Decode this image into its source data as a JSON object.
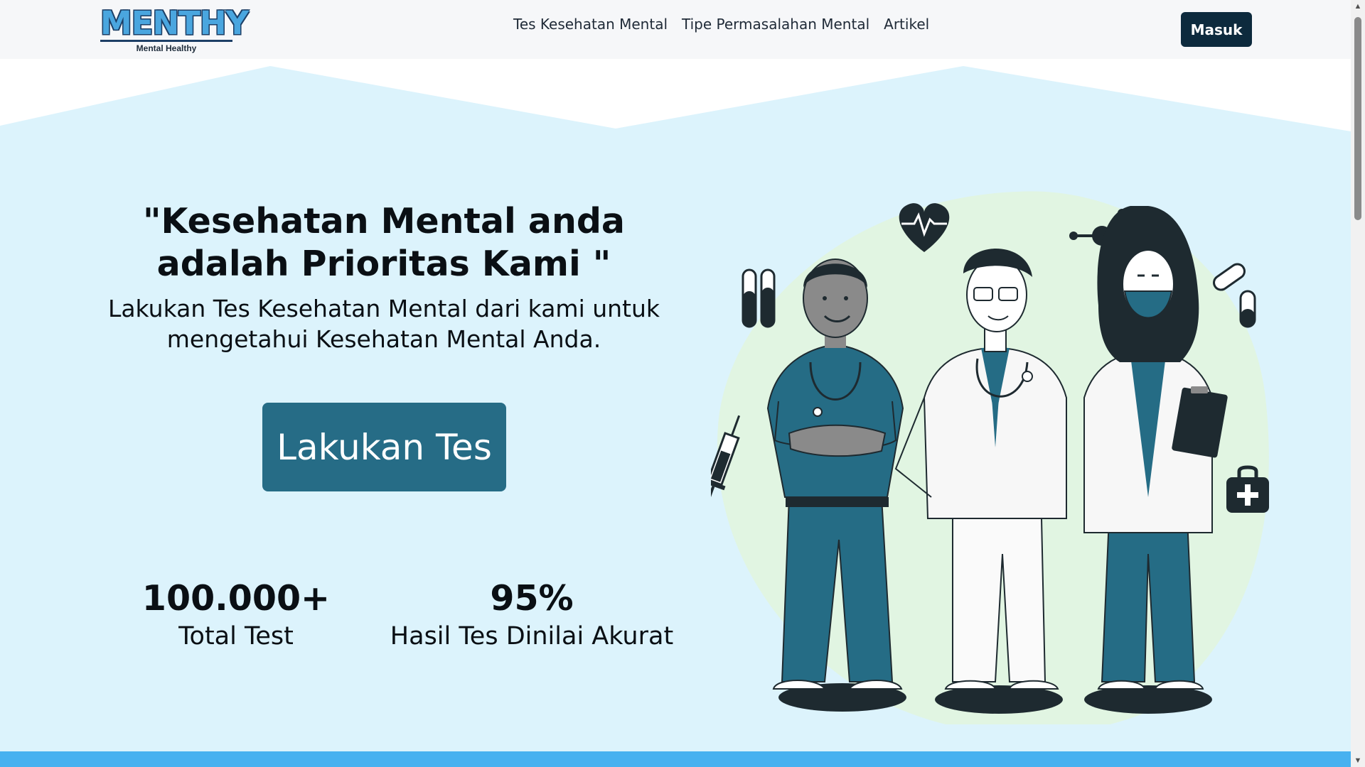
{
  "brand": {
    "logo_text": "MENTHY",
    "logo_tagline": "Mental Healthy"
  },
  "nav": {
    "links": [
      "Tes Kesehatan Mental",
      "Tipe Permasalahan Mental",
      "Artikel"
    ],
    "login_label": "Masuk"
  },
  "hero": {
    "title": "\"Kesehatan Mental anda adalah Prioritas Kami \"",
    "subtitle": "Lakukan Tes Kesehatan Mental dari kami untuk mengetahui Kesehatan Mental Anda.",
    "cta_label": "Lakukan Tes"
  },
  "stats": [
    {
      "value": "100.000+",
      "label": "Total Test"
    },
    {
      "value": "95%",
      "label": "Hasil Tes Dinilai Akurat"
    }
  ],
  "colors": {
    "hero_bg": "#dcf3fc",
    "accent": "#266c86",
    "nav_button": "#0d2a3d",
    "bottom_bar": "#47b1f0",
    "blob": "#e1f5e2"
  },
  "illustration": {
    "icons": [
      "test-tubes-icon",
      "heart-rate-icon",
      "molecule-icon",
      "pill-icon",
      "syringe-icon",
      "medical-kit-icon"
    ]
  }
}
